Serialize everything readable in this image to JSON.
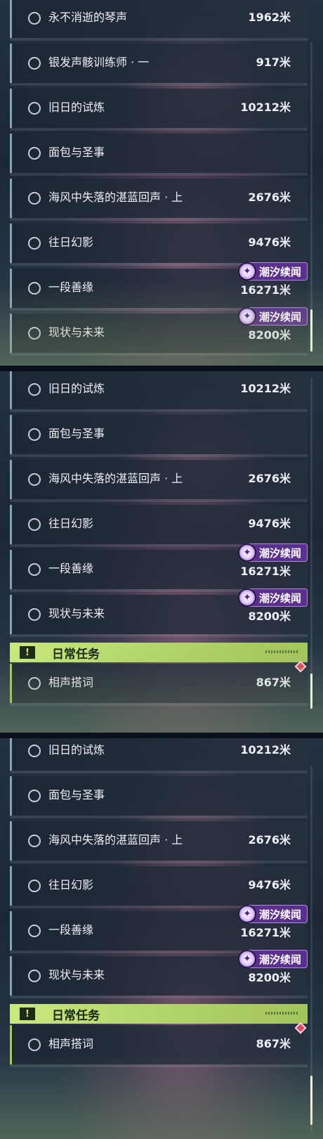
{
  "screens": [
    {
      "quests": [
        {
          "name": "永不消逝的琴声",
          "distance": "1962米"
        },
        {
          "name": "银发声骸训练师 · 一",
          "distance": "917米"
        },
        {
          "name": "旧日的试炼",
          "distance": "10212米"
        },
        {
          "name": "面包与圣事",
          "distance": ""
        },
        {
          "name": "海风中失落的湛蓝回声 · 上",
          "distance": "2676米"
        },
        {
          "name": "往日幻影",
          "distance": "9476米"
        },
        {
          "name": "一段善缘",
          "distance": "16271米",
          "tag": "潮汐续闻"
        },
        {
          "name": "现状与未来",
          "distance": "8200米",
          "tag": "潮汐续闻"
        }
      ]
    },
    {
      "quests": [
        {
          "name": "旧日的试炼",
          "distance": "10212米"
        },
        {
          "name": "面包与圣事",
          "distance": ""
        },
        {
          "name": "海风中失落的湛蓝回声 · 上",
          "distance": "2676米"
        },
        {
          "name": "往日幻影",
          "distance": "9476米"
        },
        {
          "name": "一段善缘",
          "distance": "16271米",
          "tag": "潮汐续闻"
        },
        {
          "name": "现状与未来",
          "distance": "8200米",
          "tag": "潮汐续闻"
        }
      ],
      "section": {
        "title": "日常任务",
        "icon": "exclamation-icon"
      },
      "daily_quests": [
        {
          "name": "相声搭词",
          "distance": "867米"
        }
      ]
    },
    {
      "quests": [
        {
          "name": "旧日的试炼",
          "distance": "10212米"
        },
        {
          "name": "面包与圣事",
          "distance": ""
        },
        {
          "name": "海风中失落的湛蓝回声 · 上",
          "distance": "2676米"
        },
        {
          "name": "往日幻影",
          "distance": "9476米"
        },
        {
          "name": "一段善缘",
          "distance": "16271米",
          "tag": "潮汐续闻"
        },
        {
          "name": "现状与未来",
          "distance": "8200米",
          "tag": "潮汐续闻"
        }
      ],
      "section": {
        "title": "日常任务",
        "icon": "exclamation-icon"
      },
      "daily_quests": [
        {
          "name": "相声搭词",
          "distance": "867米"
        }
      ]
    }
  ],
  "colors": {
    "section_accent": "#b6d86c",
    "tag_background": "#5a2f8e",
    "tracked_marker": "#e24b5f"
  }
}
